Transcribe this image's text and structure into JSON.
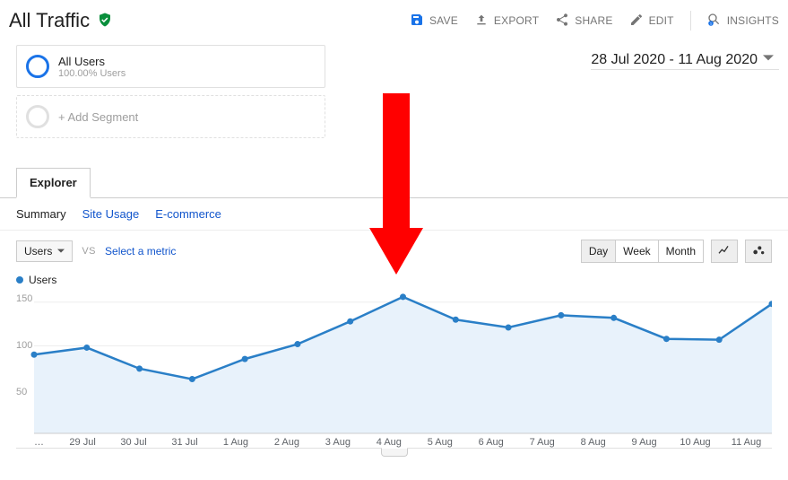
{
  "header": {
    "title": "All Traffic",
    "actions": {
      "save": "SAVE",
      "export": "EXPORT",
      "share": "SHARE",
      "edit": "EDIT",
      "insights": "INSIGHTS"
    }
  },
  "segments": {
    "primary": {
      "title": "All Users",
      "subtitle": "100.00% Users"
    },
    "add": {
      "label": "+ Add Segment"
    }
  },
  "date_range": "28 Jul 2020 - 11 Aug 2020",
  "tabs": {
    "explorer": "Explorer"
  },
  "subnav": {
    "summary": "Summary",
    "site_usage": "Site Usage",
    "ecommerce": "E-commerce"
  },
  "controls": {
    "metric_dd": "Users",
    "vs": "VS",
    "select_metric": "Select a metric",
    "granularity": {
      "day": "Day",
      "week": "Week",
      "month": "Month"
    }
  },
  "legend": {
    "series1": "Users"
  },
  "ylabels": {
    "y50": "50",
    "y100": "100",
    "y150": "150"
  },
  "xlabels": {
    "x0": "…",
    "x1": "29 Jul",
    "x2": "30 Jul",
    "x3": "31 Jul",
    "x4": "1 Aug",
    "x5": "2 Aug",
    "x6": "3 Aug",
    "x7": "4 Aug",
    "x8": "5 Aug",
    "x9": "6 Aug",
    "x10": "7 Aug",
    "x11": "8 Aug",
    "x12": "9 Aug",
    "x13": "10 Aug",
    "x14": "11 Aug"
  },
  "chart_data": {
    "type": "line",
    "title": "",
    "xlabel": "",
    "ylabel": "Users",
    "ylim": [
      0,
      160
    ],
    "series": [
      {
        "name": "Users",
        "color": "#2a7fc7",
        "categories": [
          "28 Jul",
          "29 Jul",
          "30 Jul",
          "31 Jul",
          "1 Aug",
          "2 Aug",
          "3 Aug",
          "4 Aug",
          "5 Aug",
          "6 Aug",
          "7 Aug",
          "8 Aug",
          "9 Aug",
          "10 Aug",
          "11 Aug"
        ],
        "values": [
          90,
          98,
          74,
          62,
          85,
          102,
          128,
          156,
          130,
          121,
          135,
          132,
          108,
          107,
          148
        ]
      }
    ]
  }
}
